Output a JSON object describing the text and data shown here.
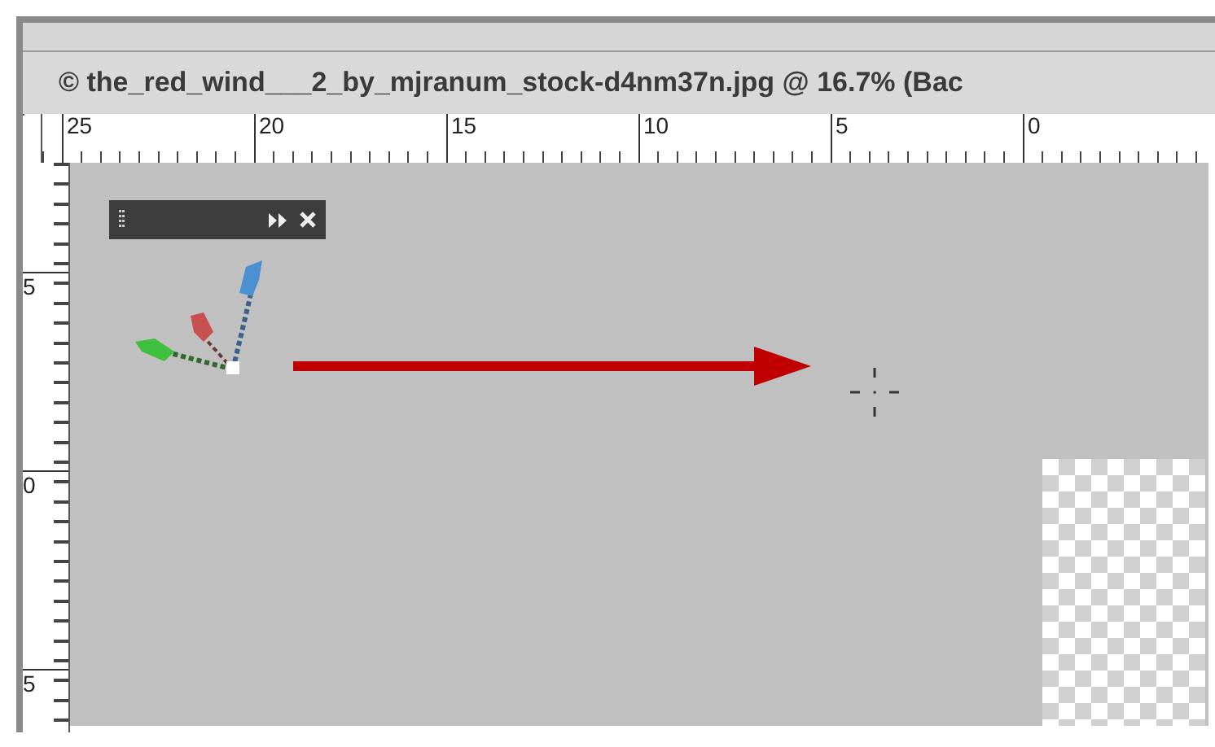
{
  "document": {
    "title": "© the_red_wind___2_by_mjranum_stock-d4nm37n.jpg @ 16.7% (Bac"
  },
  "horizontal_ruler": {
    "labels": [
      "25",
      "20",
      "15",
      "10",
      "5",
      "0"
    ]
  },
  "vertical_ruler": {
    "labels": [
      "5",
      "0",
      "5"
    ]
  }
}
